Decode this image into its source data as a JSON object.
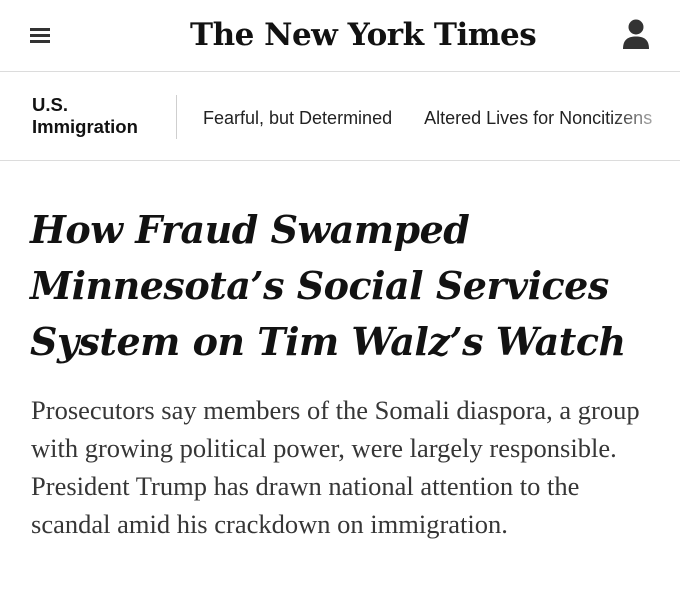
{
  "header": {
    "masthead": "The New York Times",
    "menu_icon": "hamburger-menu-icon",
    "account_icon": "user-account-icon"
  },
  "section_nav": {
    "section": "U.S. Immigration",
    "links": [
      {
        "label": "Fearful, but Determined"
      },
      {
        "label": "Altered Lives for Noncitizens"
      }
    ]
  },
  "article": {
    "headline": "How Fraud Swamped Minnesota’s Social Services System on Tim Walz’s Watch",
    "summary": "Prosecutors say members of the Somali diaspora, a group with growing political power, were largely responsible. President Trump has drawn national attention to the scandal amid his crackdown on immigration."
  },
  "colors": {
    "text": "#121212",
    "summary_text": "#363636",
    "divider": "#dcdcdc",
    "background": "#ffffff"
  }
}
